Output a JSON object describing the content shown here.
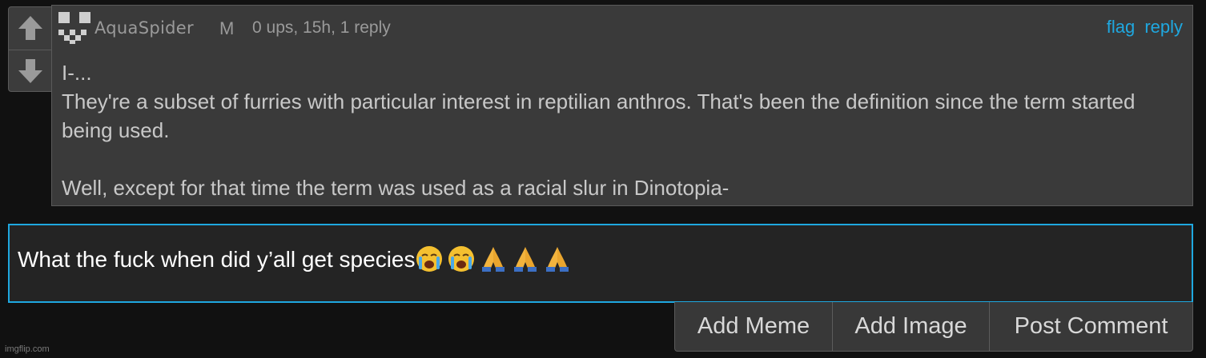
{
  "comment": {
    "username": "AquaSpider",
    "gender": "M",
    "meta": "0 ups, 15h, 1 reply",
    "actions": {
      "flag": "flag",
      "reply": "reply"
    },
    "body": {
      "line1": "I-...",
      "line2": "They're a subset of furries with particular interest in reptilian anthros. That's been the definition since the term started being used.",
      "line3": "Well, except for that time the term was used as a racial slur in Dinotopia-"
    },
    "vote_up_icon": "arrow-up-icon",
    "vote_down_icon": "arrow-down-icon"
  },
  "reply_input": {
    "value": "What the fuck when did y’all get species",
    "emoji": [
      "loudly-crying-face",
      "loudly-crying-face",
      "folded-hands",
      "folded-hands",
      "folded-hands"
    ]
  },
  "buttons": {
    "add_meme": "Add Meme",
    "add_image": "Add Image",
    "post_comment": "Post Comment"
  },
  "watermark": "imgflip.com",
  "colors": {
    "accent": "#1fa8e0",
    "background": "#111111",
    "panel": "#3a3a3a",
    "muted_text": "#9a9a9a"
  }
}
